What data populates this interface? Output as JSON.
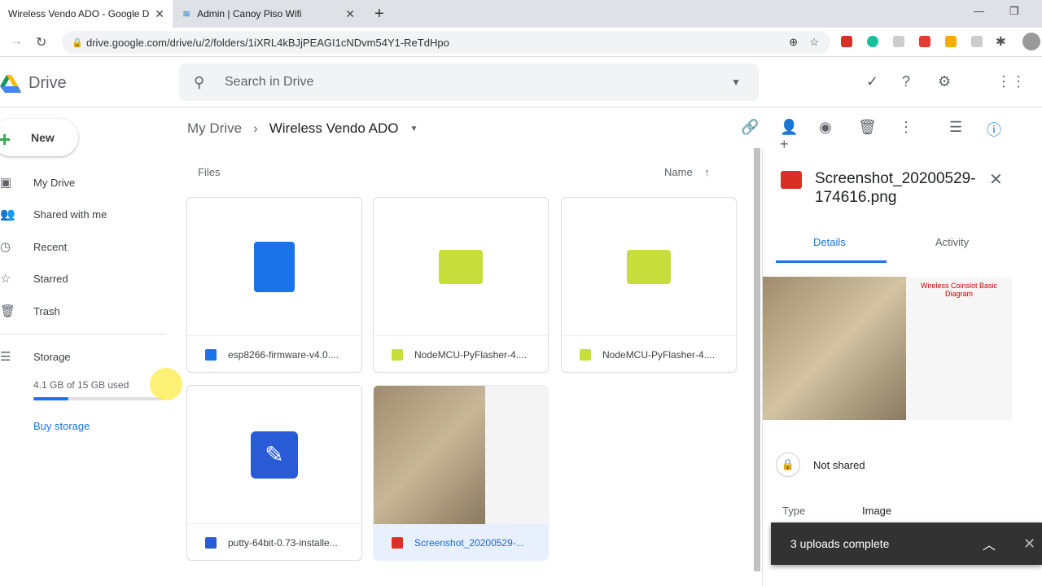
{
  "browser": {
    "tabs": [
      {
        "label": "Wireless Vendo ADO - Google D",
        "active": true
      },
      {
        "label": "Admin | Canoy Piso Wifi",
        "active": false
      }
    ],
    "url": "drive.google.com/drive/u/2/folders/1iXRL4kBJjPEAGI1cNDvm54Y1-ReTdHpo"
  },
  "app": {
    "name": "Drive",
    "search_placeholder": "Search in Drive"
  },
  "sidebar": {
    "new_label": "New",
    "items": [
      {
        "label": "My Drive",
        "icon": "drive-icon"
      },
      {
        "label": "Shared with me",
        "icon": "people-icon"
      },
      {
        "label": "Recent",
        "icon": "clock-icon"
      },
      {
        "label": "Starred",
        "icon": "star-icon"
      },
      {
        "label": "Trash",
        "icon": "trash-icon"
      }
    ],
    "storage_label": "Storage",
    "storage_used": "4.1 GB of 15 GB used",
    "storage_fraction": 0.27,
    "buy_storage": "Buy storage"
  },
  "main": {
    "breadcrumb": [
      "My Drive",
      "Wireless Vendo ADO"
    ],
    "section": "Files",
    "sort": "Name",
    "files": [
      {
        "name": "esp8266-firmware-v4.0....",
        "type": "doc",
        "color": "#1a73e8"
      },
      {
        "name": "NodeMCU-PyFlasher-4....",
        "type": "exe",
        "color": "#c6dd3c"
      },
      {
        "name": "NodeMCU-PyFlasher-4....",
        "type": "exe",
        "color": "#c6dd3c"
      },
      {
        "name": "putty-64bit-0.73-installe...",
        "type": "installer",
        "color": "#2a5bd7"
      },
      {
        "name": "Screenshot_20200529-...",
        "type": "image",
        "color": "#d93025",
        "selected": true
      }
    ]
  },
  "details": {
    "title": "Screenshot_20200529-174616.png",
    "tabs": [
      "Details",
      "Activity"
    ],
    "sharing": "Not shared",
    "props": [
      {
        "label": "Type",
        "value": "Image"
      }
    ],
    "preview_caption": "Wireless Coinslot Basic Diagram"
  },
  "toast": {
    "text": "3 uploads complete"
  }
}
